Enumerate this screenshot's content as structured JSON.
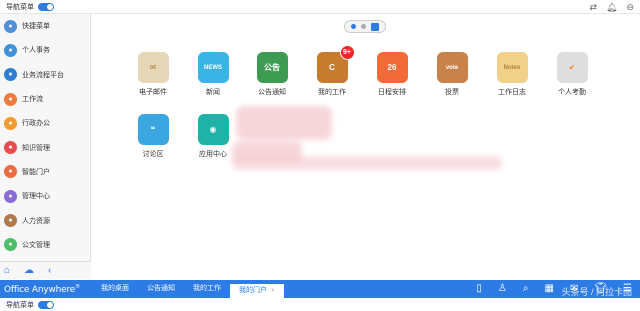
{
  "top": {
    "nav_toggle_label": "导航菜单",
    "icons": [
      "user-switch-icon",
      "bell-icon",
      "minimize-icon"
    ]
  },
  "sidebar": {
    "items": [
      {
        "label": "快捷菜单",
        "icon": "quick-menu-icon",
        "color": "#4f8fd6"
      },
      {
        "label": "个人事务",
        "icon": "person-icon",
        "color": "#3f92d8"
      },
      {
        "label": "业务流程平台",
        "icon": "workflow-platform-icon",
        "color": "#2f7dd1"
      },
      {
        "label": "工作流",
        "icon": "workflow-icon",
        "color": "#f07b3f"
      },
      {
        "label": "行政办公",
        "icon": "office-icon",
        "color": "#f29b2b"
      },
      {
        "label": "知识管理",
        "icon": "knowledge-icon",
        "color": "#e94d4d"
      },
      {
        "label": "智能门户",
        "icon": "portal-icon",
        "color": "#ef6a43"
      },
      {
        "label": "管理中心",
        "icon": "admin-icon",
        "color": "#8a6bd6"
      },
      {
        "label": "人力资源",
        "icon": "hr-icon",
        "color": "#b07a4f"
      },
      {
        "label": "公文管理",
        "icon": "document-mgmt-icon",
        "color": "#4fbf6a"
      }
    ],
    "bottom_icons": [
      "home-icon",
      "cloud-icon",
      "collapse-left-icon"
    ]
  },
  "apps": [
    {
      "label": "电子邮件",
      "icon": "email-icon",
      "color": "#e6d7b9",
      "glyph": "✉"
    },
    {
      "label": "新闻",
      "icon": "news-icon",
      "color": "#3ab3e6",
      "glyph": "NEWS"
    },
    {
      "label": "公告通知",
      "icon": "notice-icon",
      "color": "#3e9b52",
      "glyph": "公告"
    },
    {
      "label": "我的工作",
      "icon": "my-work-icon",
      "color": "#c77b2e",
      "glyph": "C",
      "badge": "9+"
    },
    {
      "label": "日程安排",
      "icon": "calendar-icon",
      "color": "#f26a37",
      "glyph": "26"
    },
    {
      "label": "投票",
      "icon": "vote-icon",
      "color": "#c9834a",
      "glyph": "vote"
    },
    {
      "label": "工作日志",
      "icon": "worklog-icon",
      "color": "#f1d18a",
      "glyph": "Notes"
    },
    {
      "label": "个人考勤",
      "icon": "attendance-icon",
      "color": "#dedede",
      "glyph": "✔"
    },
    {
      "label": "讨论区",
      "icon": "discussion-icon",
      "color": "#3aa7e0",
      "glyph": "❝"
    },
    {
      "label": "应用中心",
      "icon": "app-center-icon",
      "color": "#1fb3a8",
      "glyph": "◉"
    }
  ],
  "bottombar": {
    "brand": "Office Anywhere",
    "brand_mark": "®",
    "tabs": [
      {
        "label": "我的桌面",
        "active": false
      },
      {
        "label": "公告通知",
        "active": false
      },
      {
        "label": "我的工作",
        "active": false
      },
      {
        "label": "我的门户",
        "active": true
      }
    ],
    "icons": [
      "mobile-icon",
      "user-icon",
      "search-icon",
      "apps-icon",
      "message-icon",
      "shirt-icon",
      "menu-icon"
    ]
  },
  "footer": {
    "nav_toggle_label": "导航菜单"
  },
  "watermark": "头条号 / 阿拉卡图"
}
